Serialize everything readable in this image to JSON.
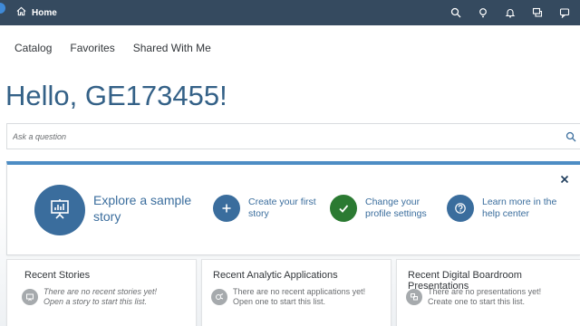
{
  "shell": {
    "home_label": "Home"
  },
  "nav": {
    "items": [
      "Catalog",
      "Favorites",
      "Shared With Me"
    ]
  },
  "greeting": "Hello, GE173455!",
  "search": {
    "placeholder": "Ask a question"
  },
  "welcome": {
    "explore_label": "Explore a sample story",
    "actions": [
      {
        "label": "Create your first story",
        "icon": "plus-icon",
        "color": "#3a6d9d"
      },
      {
        "label": "Change your profile settings",
        "icon": "check-icon",
        "color": "#2b7a32"
      },
      {
        "label": "Learn more in the help center",
        "icon": "help-icon",
        "color": "#3a6d9d"
      }
    ]
  },
  "cards": [
    {
      "title": "Recent Stories",
      "line1": "There are no recent stories yet!",
      "line2": "Open a story to start this list.",
      "italic": true
    },
    {
      "title": "Recent Analytic Applications",
      "line1": "There are no recent applications yet!",
      "line2": "Open one to start this list.",
      "italic": false
    },
    {
      "title": "Recent Digital Boardroom Presentations",
      "line1": "There are no presentations yet!",
      "line2": "Create one to start this list.",
      "italic": false
    }
  ],
  "colors": {
    "shell": "#354a5f",
    "accent": "#3a6d9d",
    "greeting": "#346187",
    "success": "#2b7a32"
  }
}
